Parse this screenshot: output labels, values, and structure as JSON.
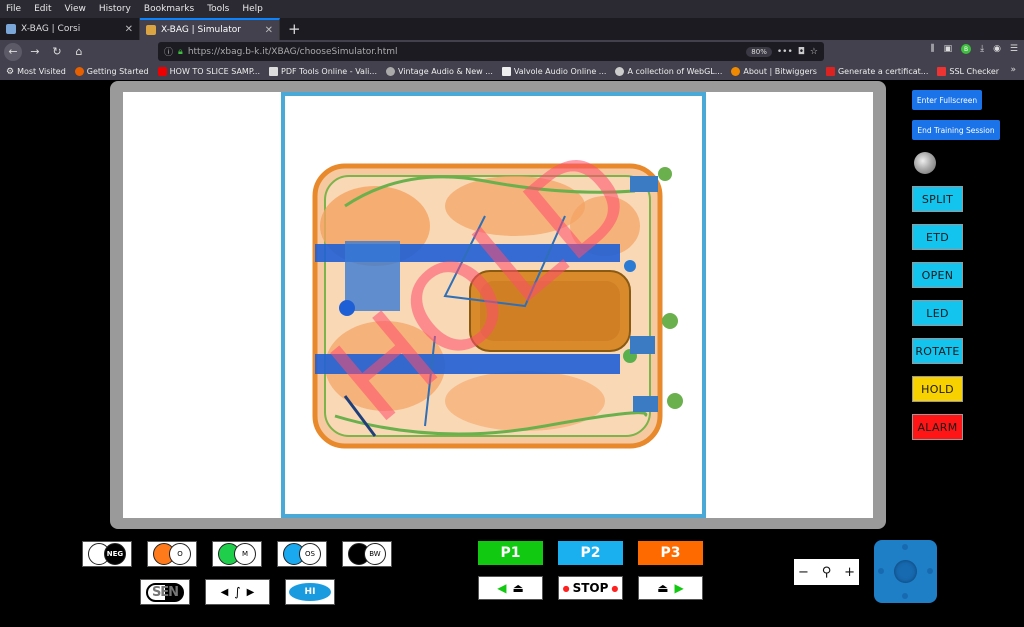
{
  "browser": {
    "menu": [
      "File",
      "Edit",
      "View",
      "History",
      "Bookmarks",
      "Tools",
      "Help"
    ],
    "tabs": [
      {
        "title": "X-BAG | Corsi",
        "active": false
      },
      {
        "title": "X-BAG | Simulator",
        "active": true
      }
    ],
    "url": "https://xbag.b-k.it/XBAG/chooseSimulator.html",
    "zoom": "80%",
    "bookmarks": [
      "Most Visited",
      "Getting Started",
      "HOW TO SLICE SAMP...",
      "PDF Tools Online - Vali...",
      "Vintage Audio & New ...",
      "Valvole Audio Online ...",
      "A collection of WebGL...",
      "About | Bitwiggers",
      "Generate a certificat...",
      "SSL Checker"
    ]
  },
  "simulator": {
    "overlay_text": "HOLD",
    "side_buttons": {
      "fullscreen": "Enter Fullscreen",
      "end_training": "End Training Session",
      "split": "SPLIT",
      "etd": "ETD",
      "open": "OPEN",
      "led": "LED",
      "rotate": "ROTATE",
      "hold": "HOLD",
      "alarm": "ALARM"
    },
    "filters": {
      "neg": "NEG",
      "o": "O",
      "m": "M",
      "os": "OS",
      "bw": "BW",
      "sen": "SEN",
      "hi": "HI"
    },
    "belt": {
      "p1": "P1",
      "p2": "P2",
      "p3": "P3",
      "stop": "STOP"
    },
    "colors": {
      "cyan": "#13c4ee",
      "hold": "#f7d100",
      "alarm": "#ff1515",
      "p1": "#12c912",
      "p2": "#1ab0f0",
      "p3": "#ff6a00",
      "frame": "#4aa9d6"
    }
  }
}
